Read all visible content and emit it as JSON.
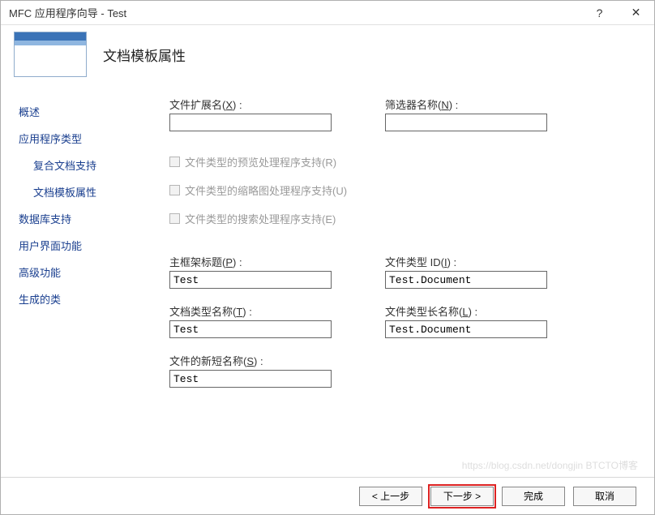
{
  "titlebar": {
    "title": "MFC 应用程序向导 - Test",
    "help": "?",
    "close": "✕"
  },
  "header": {
    "title": "文档模板属性"
  },
  "sidebar": {
    "items": [
      {
        "label": "概述",
        "sub": false
      },
      {
        "label": "应用程序类型",
        "sub": false
      },
      {
        "label": "复合文档支持",
        "sub": true
      },
      {
        "label": "文档模板属性",
        "sub": true
      },
      {
        "label": "数据库支持",
        "sub": false
      },
      {
        "label": "用户界面功能",
        "sub": false
      },
      {
        "label": "高级功能",
        "sub": false
      },
      {
        "label": "生成的类",
        "sub": false
      }
    ]
  },
  "form": {
    "file_ext": {
      "label_pre": "文件扩展名(",
      "mn": "X",
      "label_post": ") :",
      "value": ""
    },
    "filter_name": {
      "label_pre": "筛选器名称(",
      "mn": "N",
      "label_post": ") :",
      "value": ""
    },
    "cb_preview": {
      "label_pre": "文件类型的预览处理程序支持(",
      "mn": "R",
      "label_post": ")"
    },
    "cb_thumb": {
      "label_pre": "文件类型的缩略图处理程序支持(",
      "mn": "U",
      "label_post": ")"
    },
    "cb_search": {
      "label_pre": "文件类型的搜索处理程序支持(",
      "mn": "E",
      "label_post": ")"
    },
    "main_frame": {
      "label_pre": "主框架标题(",
      "mn": "P",
      "label_post": ") :",
      "value": "Test"
    },
    "file_type_id": {
      "label_pre": "文件类型 ID(",
      "mn": "I",
      "label_post": ") :",
      "value": "Test.Document"
    },
    "doc_type_name": {
      "label_pre": "文档类型名称(",
      "mn": "T",
      "label_post": ") :",
      "value": "Test"
    },
    "file_type_long": {
      "label_pre": "文件类型长名称(",
      "mn": "L",
      "label_post": ") :",
      "value": "Test.Document"
    },
    "file_new_short": {
      "label_pre": "文件的新短名称(",
      "mn": "S",
      "label_post": ") :",
      "value": "Test"
    }
  },
  "buttons": {
    "prev": "< 上一步",
    "next": "下一步 >",
    "finish": "完成",
    "cancel": "取消"
  },
  "watermark": "https://blog.csdn.net/dongjin BTCTO博客"
}
